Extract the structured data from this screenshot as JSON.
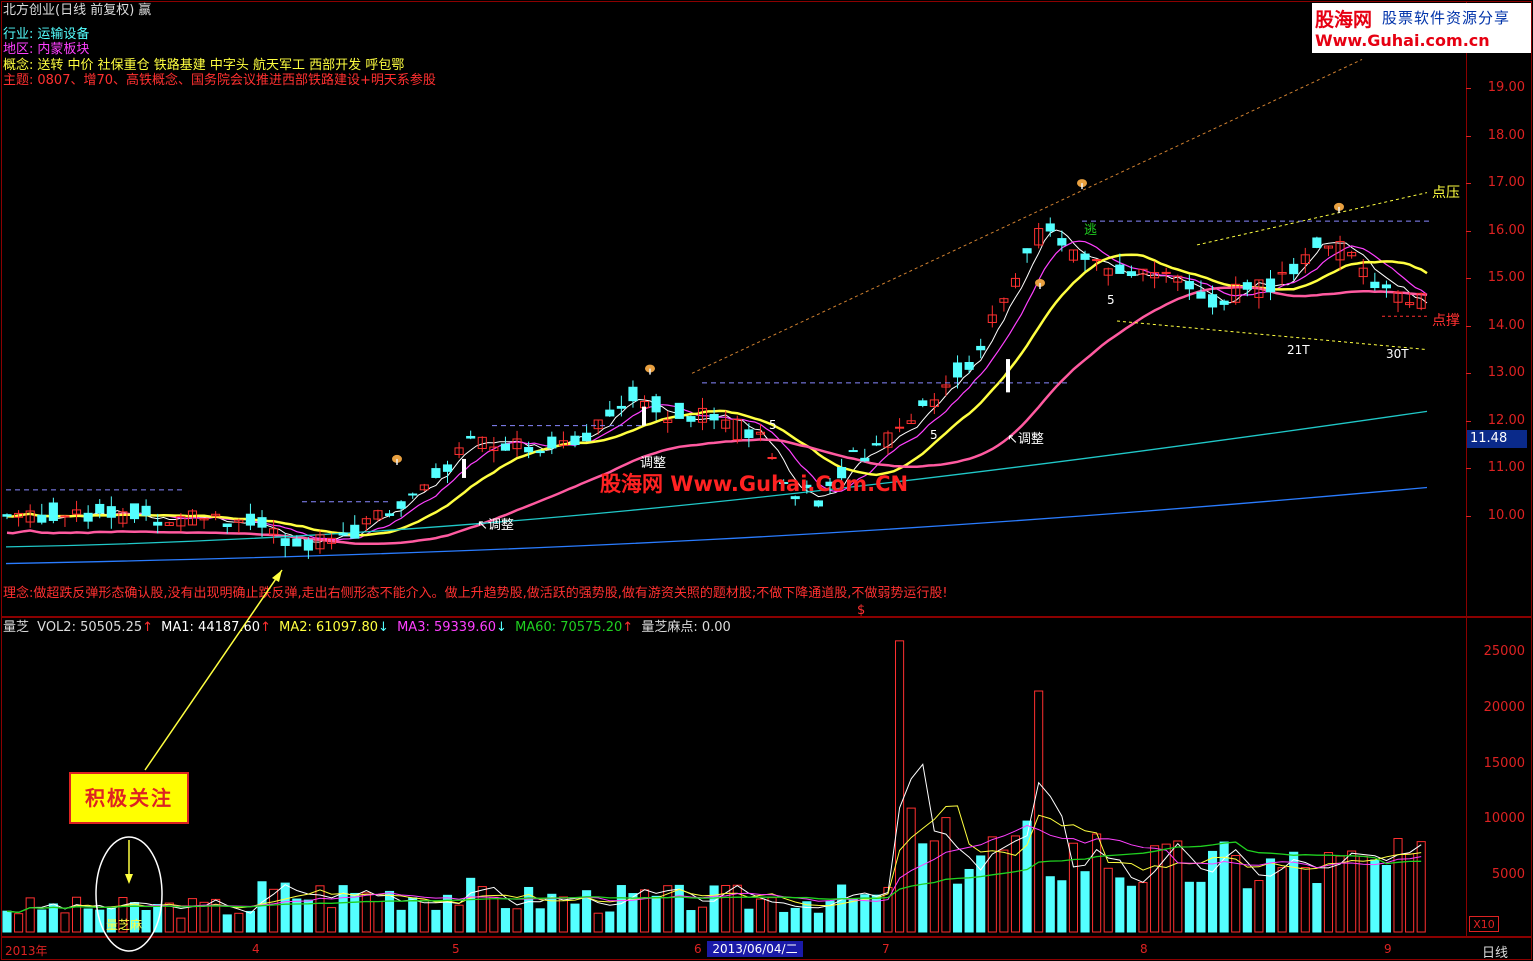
{
  "window": {
    "title": "北方创业(日线 前复权)",
    "title_glyph": "赢"
  },
  "info": {
    "industry_label": "行业:",
    "industry_value": "运输设备",
    "region_label": "地区:",
    "region_value": "内蒙板块",
    "concept_label": "概念:",
    "concept_value": "送转 中价 社保重仓 铁路基建 中字头 航天军工 西部开发 呼包鄂",
    "theme_label": "主题:",
    "theme_value": "0807、增70、高铁概念、国务院会议推进西部铁路建设+明天系参股"
  },
  "watermark": {
    "brand": "股海网",
    "slogan": "股票软件资源分享",
    "url": "Www.Guhai.com.cn",
    "center": "股海网 Www.Guhai.Com.CN"
  },
  "colors": {
    "up": "#ff3030",
    "down": "#54ffff",
    "ma5": "#ffffff",
    "ma10": "#ff40ff",
    "ma20": "#ffff40",
    "ma60": "#ff5aa0",
    "ma120": "#20c8c8",
    "ma250": "#2a7cff",
    "axis": "#d22222",
    "accent": "#ffff00"
  },
  "price_axis": [
    "19.00",
    "18.00",
    "17.00",
    "16.00",
    "15.00",
    "14.00",
    "13.00",
    "12.00",
    "11.00",
    "10.00"
  ],
  "current_price": "11.48",
  "annotations": {
    "adjust": "调整",
    "escape": "逃",
    "resistance": "点压",
    "support": "点撑",
    "t21": "21T",
    "t30": "30T",
    "five_a": "5",
    "five_b": "5",
    "five_c": "5",
    "dollar": "$"
  },
  "philosophy": "理念:做超跌反弹形态确认股,没有出现明确止跌反弹,走出右侧形态不能介入。做上升趋势股,做活跃的强势股,做有游资关照的题材股;不做下降通道股,不做弱势运行股!",
  "volume": {
    "indicator": "量芝",
    "vol_label": "VOL2: 50505.25",
    "ma1_label": "MA1: 44187.60",
    "ma2_label": "MA2: 61097.80",
    "ma3_label": "MA3: 59339.60",
    "ma60_label": "MA60: 70575.20",
    "point_label": "量芝麻点: 0.00",
    "axis": [
      "25000",
      "20000",
      "15000",
      "10000",
      "5000"
    ],
    "multiplier": "X10",
    "circle_label": "量芝麻"
  },
  "callout": "积极关注",
  "date_axis": {
    "labels": [
      "2013年",
      "4",
      "5",
      "6",
      "7",
      "8",
      "9"
    ],
    "cursor_date": "2013/06/04/二",
    "period": "日线"
  },
  "chart_data": {
    "type": "candlestick",
    "symbol": "北方创业",
    "period": "日线",
    "ylim": [
      9.0,
      20.0
    ],
    "current_price": 11.48,
    "volume_ylim": [
      0,
      28000
    ],
    "volume_axis": [
      5000,
      10000,
      15000,
      20000,
      25000
    ],
    "notable_volume": [
      {
        "month": "7",
        "value": 26000
      },
      {
        "month": "7-8",
        "value": 21500
      }
    ]
  }
}
